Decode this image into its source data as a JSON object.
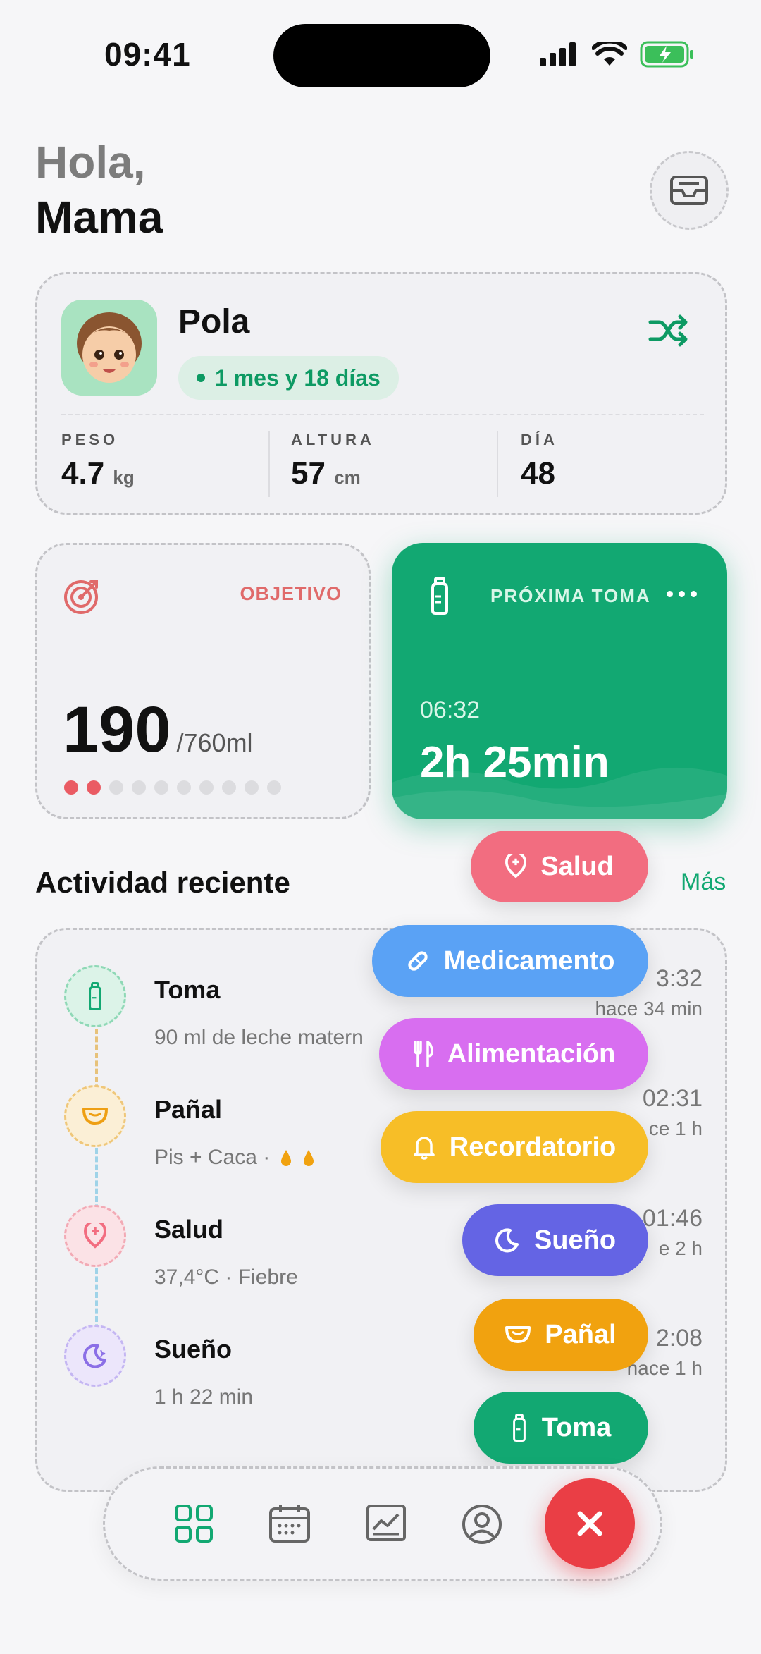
{
  "status_bar": {
    "time": "09:41"
  },
  "greeting": {
    "hello": "Hola,",
    "name": "Mama"
  },
  "profile": {
    "name": "Pola",
    "age": "1 mes y 18 días",
    "stats": [
      {
        "label": "PESO",
        "value": "4.7",
        "unit": "kg"
      },
      {
        "label": "ALTURA",
        "value": "57",
        "unit": "cm"
      },
      {
        "label": "DÍA",
        "value": "48",
        "unit": ""
      }
    ]
  },
  "goal": {
    "label": "OBJETIVO",
    "amount": "190",
    "total": "/760ml",
    "progress_filled": 2,
    "progress_total": 10
  },
  "next_feed": {
    "label": "PRÓXIMA TOMA",
    "time": "06:32",
    "countdown": "2h 25min"
  },
  "activity": {
    "title": "Actividad reciente",
    "more": "Más",
    "items": [
      {
        "title": "Toma",
        "subtitle": "90 ml de leche matern",
        "time": "3:32",
        "ago": "hace 34 min",
        "icon": "bottle-icon"
      },
      {
        "title": "Pañal",
        "subtitle": "Pis + Caca ·",
        "time": "02:31",
        "ago": "ce 1 h",
        "icon": "diaper-icon"
      },
      {
        "title": "Salud",
        "subtitle": "37,4°C · Fiebre",
        "time": "01:46",
        "ago": "e 2 h",
        "icon": "health-icon"
      },
      {
        "title": "Sueño",
        "subtitle": "1 h 22 min",
        "time": "2:08",
        "ago": "hace 1 h",
        "icon": "moon-icon"
      }
    ]
  },
  "fab_menu": {
    "salud": "Salud",
    "medicamento": "Medicamento",
    "alimentacion": "Alimentación",
    "recordatorio": "Recordatorio",
    "sueno": "Sueño",
    "panal": "Pañal",
    "toma": "Toma"
  },
  "colors": {
    "accent": "#12a872",
    "salud": "#f26d80",
    "medicamento": "#5aa2f5",
    "alimentacion": "#d86ef0",
    "recordatorio": "#f7be27",
    "sueno": "#6464e4",
    "panal": "#f1a20f",
    "toma": "#12a872",
    "close": "#ea3e45"
  },
  "nav": [
    "grid-icon",
    "calendar-icon",
    "chart-icon",
    "profile-icon",
    "close-icon"
  ]
}
